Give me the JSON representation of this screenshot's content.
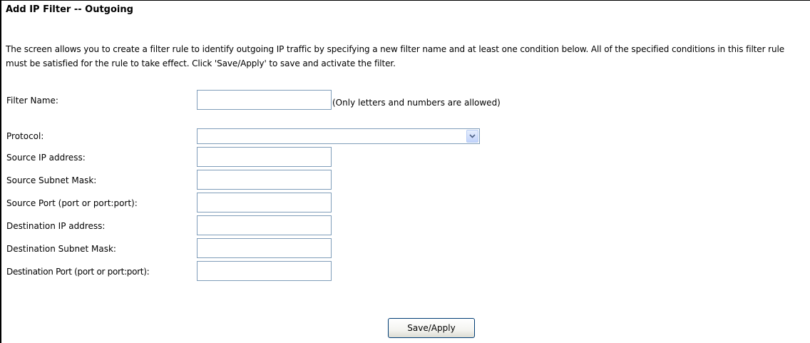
{
  "page": {
    "title": "Add IP Filter -- Outgoing",
    "description": "The screen allows you to create a filter rule to identify outgoing IP traffic by specifying a new filter name and at least one condition below. All of the specified conditions in this filter rule must be satisfied for the rule to take effect. Click 'Save/Apply' to save and activate the filter."
  },
  "form": {
    "filter_name": {
      "label": "Filter Name:",
      "value": "",
      "hint": "(Only letters and numbers are allowed)"
    },
    "protocol": {
      "label": "Protocol:",
      "selected": ""
    },
    "source_ip": {
      "label": "Source IP address:",
      "value": ""
    },
    "source_mask": {
      "label": "Source Subnet Mask:",
      "value": ""
    },
    "source_port": {
      "label": "Source Port (port or port:port):",
      "value": ""
    },
    "dest_ip": {
      "label": "Destination IP address:",
      "value": ""
    },
    "dest_mask": {
      "label": "Destination Subnet Mask:",
      "value": ""
    },
    "dest_port": {
      "label": "Destination Port (port or port:port):",
      "value": ""
    }
  },
  "actions": {
    "save_apply_label": "Save/Apply"
  },
  "icons": {
    "dropdown": "chevron-down-icon"
  },
  "colors": {
    "input_border": "#7f9db9",
    "button_border": "#003c74",
    "dropdown_arrow": "#4d6185"
  }
}
